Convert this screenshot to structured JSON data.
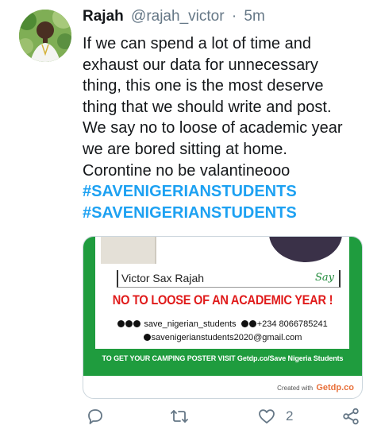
{
  "tweet": {
    "display_name": "Rajah",
    "handle": "@rajah_victor",
    "separator": "·",
    "time": "5m",
    "text_lines": [
      "If we can spend a lot of time and",
      "exhaust our data for unnecessary",
      "thing, this one is the most deserve",
      "thing that we should write and post.",
      "We say no to loose of academic year",
      "we are bored sitting at home.",
      "Corontine no be valantineooo"
    ],
    "hashtags": [
      "#SAVENIGERIANSTUDENTS",
      "#SAVENIGERIANSTUDENTS"
    ]
  },
  "poster": {
    "name_field": "Victor Sax Rajah",
    "say": "Say",
    "slogan": "NO TO LOOSE OF AN ACADEMIC YEAR !",
    "social_handle": "save_nigerian_students",
    "phone": "+234 8066785241",
    "email": "savenigerianstudents2020@gmail.com",
    "banner": "TO GET YOUR CAMPING POSTER VISIT Getdp.co/Save Nigeria Students",
    "credit_prefix": "Created with",
    "credit_brand": "Getdp.co"
  },
  "actions": {
    "reply_icon": "reply-icon",
    "retweet_icon": "retweet-icon",
    "like_icon": "like-icon",
    "like_count": "2",
    "share_icon": "share-icon"
  },
  "colors": {
    "hashtag": "#1da1f2",
    "poster_green": "#1f9c3e",
    "slogan_red": "#e01b1b",
    "muted": "#657786"
  }
}
